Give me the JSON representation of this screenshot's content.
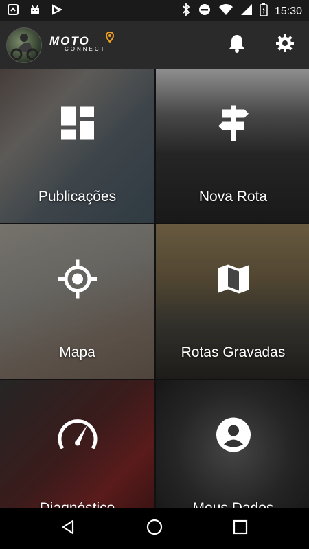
{
  "status_bar": {
    "time": "15:30",
    "left_icons": [
      "notification-icon",
      "android-icon",
      "download-icon"
    ],
    "right_icons": [
      "bluetooth-icon",
      "do-not-disturb-icon",
      "wifi-icon",
      "signal-icon",
      "battery-charging-icon"
    ]
  },
  "app_bar": {
    "logo_primary": "MOTO",
    "logo_secondary": "CONNECT",
    "notification_icon": "bell-icon",
    "settings_icon": "gear-icon"
  },
  "tiles": [
    {
      "label": "Publicações",
      "icon": "dashboard-icon"
    },
    {
      "label": "Nova Rota",
      "icon": "signpost-icon"
    },
    {
      "label": "Mapa",
      "icon": "gps-target-icon"
    },
    {
      "label": "Rotas Gravadas",
      "icon": "map-icon"
    },
    {
      "label": "Diagnóstico",
      "icon": "speedometer-icon"
    },
    {
      "label": "Meus Dados",
      "icon": "account-circle-icon"
    }
  ],
  "nav_bar": {
    "back": "back-icon",
    "home": "home-icon",
    "recents": "recents-icon"
  },
  "colors": {
    "status_bar_bg": "#1a1a1a",
    "app_bar_bg": "#2a2a2a",
    "logo_accent": "#f0a020",
    "text": "#ffffff"
  }
}
